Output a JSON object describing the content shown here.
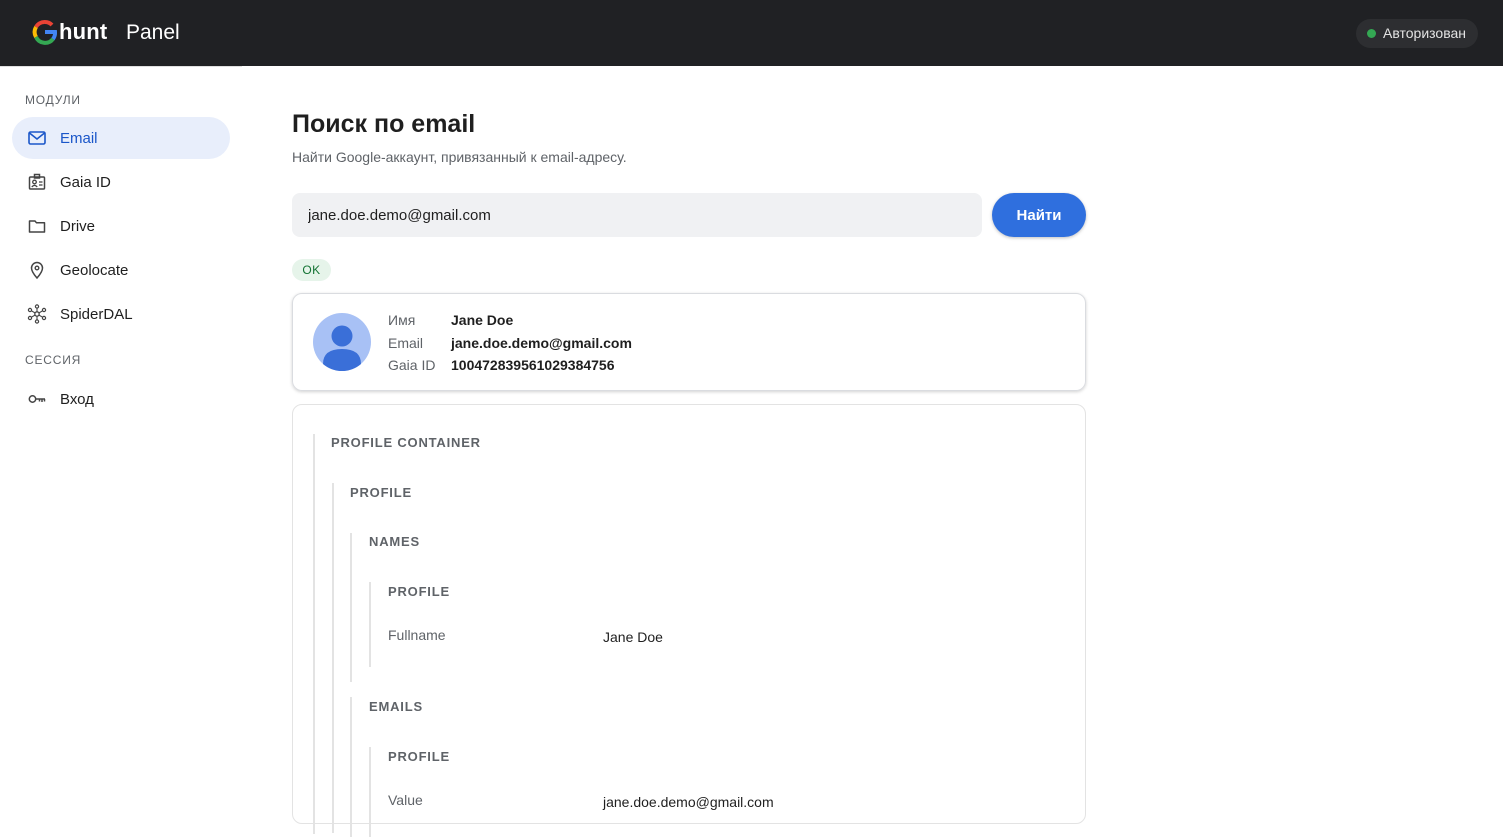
{
  "header": {
    "logo_text": "hunt",
    "panel_label": "Panel",
    "auth_status": "Авторизован"
  },
  "sidebar": {
    "modules_label": "МОДУЛИ",
    "session_label": "СЕССИЯ",
    "items": [
      {
        "label": "Email",
        "icon": "mail-icon"
      },
      {
        "label": "Gaia ID",
        "icon": "id-badge-icon"
      },
      {
        "label": "Drive",
        "icon": "folder-icon"
      },
      {
        "label": "Geolocate",
        "icon": "location-pin-icon"
      },
      {
        "label": "SpiderDAL",
        "icon": "network-icon"
      }
    ],
    "session_items": [
      {
        "label": "Вход",
        "icon": "key-icon"
      }
    ]
  },
  "main": {
    "title": "Поиск по email",
    "subtitle": "Найти Google-аккаунт, привязанный к email-адресу.",
    "search_value": "jane.doe.demo@gmail.com",
    "search_button": "Найти",
    "status_badge": "OK"
  },
  "profile": {
    "name_label": "Имя",
    "name_value": "Jane Doe",
    "email_label": "Email",
    "email_value": "jane.doe.demo@gmail.com",
    "gaia_label": "Gaia ID",
    "gaia_value": "100472839561029384756"
  },
  "tree": {
    "profile_container": "PROFILE CONTAINER",
    "profile": "PROFILE",
    "names": "NAMES",
    "names_profile": "PROFILE",
    "fullname_key": "Fullname",
    "fullname_value": "Jane Doe",
    "emails": "EMAILS",
    "emails_profile": "PROFILE",
    "value_key": "Value",
    "value_value": "jane.doe.demo@gmail.com"
  }
}
